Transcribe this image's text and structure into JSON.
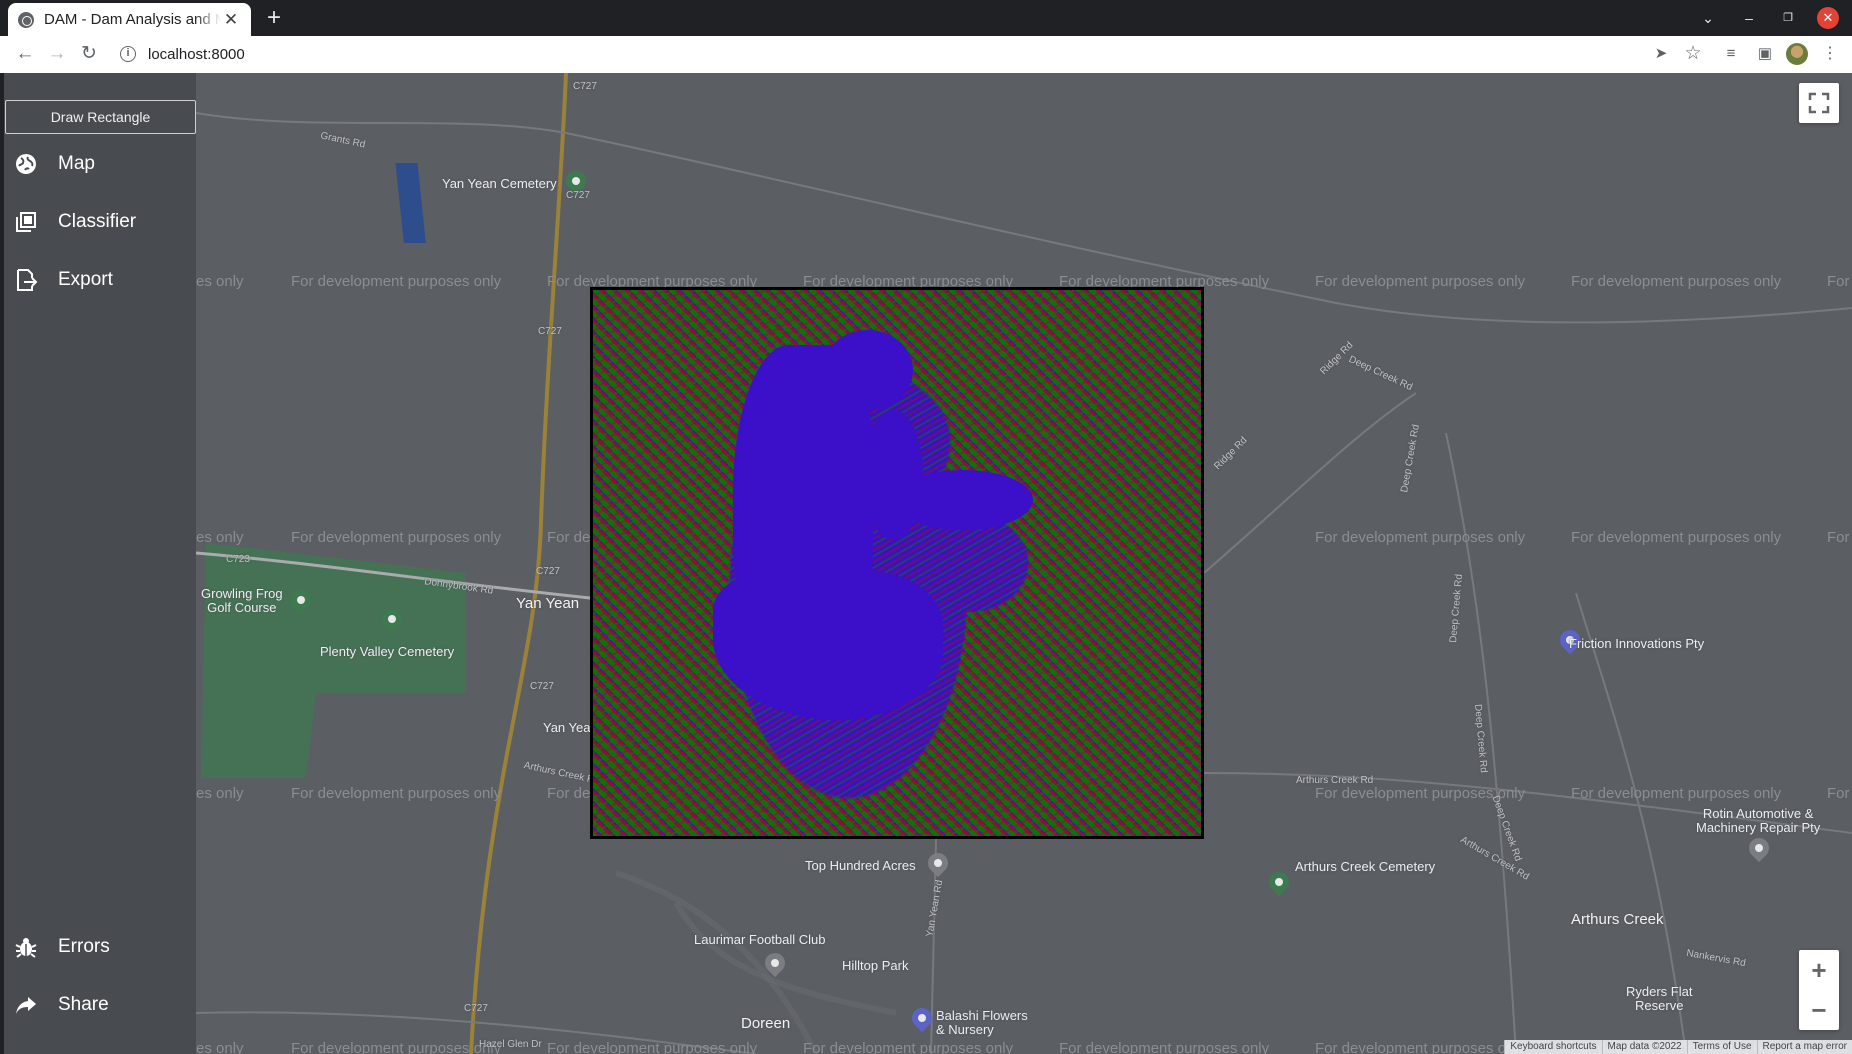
{
  "browser": {
    "tab_title": "DAM - Dam Analysis and Management",
    "new_tab": "+",
    "url": "localhost:8000"
  },
  "sidebar": {
    "draw_rectangle": "Draw Rectangle",
    "items": [
      {
        "label": "Map",
        "icon": "globe-icon"
      },
      {
        "label": "Classifier",
        "icon": "layers-icon"
      },
      {
        "label": "Export",
        "icon": "export-icon"
      },
      {
        "label": "Errors",
        "icon": "bug-icon"
      },
      {
        "label": "Share",
        "icon": "share-icon"
      }
    ]
  },
  "map": {
    "watermark": "For development purposes only",
    "watermark_fragment_left": "es only",
    "watermark_fragment_right": "For",
    "watermark_fragment_mid": "For de",
    "places": {
      "yan_yean_cemetery": "Yan Yean Cemetery",
      "grants_rd": "Grants Rd",
      "growling_frog": "Growling Frog\nGolf Course",
      "plenty_valley": "Plenty Valley Cemetery",
      "donnybrook_rd": "Donnybrook Rd",
      "yan_yean": "Yan Yean",
      "yan_yean_small": "Yan Yea",
      "arthurs_creek_rd": "Arthurs Creek Rd",
      "top_hundred": "Top Hundred Acres",
      "laurimar": "Laurimar Football Club",
      "hilltop": "Hilltop Park",
      "doreen": "Doreen",
      "balashi": "Balashi Flowers\n& Nursery",
      "hazel_glen": "Hazel Glen Dr",
      "arthurs_creek_cemetery": "Arthurs Creek Cemetery",
      "arthurs_creek": "Arthurs Creek",
      "ryders": "Ryders Flat\nReserve",
      "friction": "Friction Innovations Pty",
      "rotin": "Rotin Automotive &\nMachinery Repair Pty",
      "ridge_rd": "Ridge Rd",
      "deep_creek_rd": "Deep Creek Rd",
      "nankervis": "Nankervis Rd",
      "c727": "C727",
      "c723": "C723",
      "yan_yean_rd": "Yan Yean Rd"
    },
    "zoom_in": "+",
    "zoom_out": "−",
    "attribution": {
      "keyboard": "Keyboard shortcuts",
      "mapdata": "Map data ©2022",
      "terms": "Terms of Use",
      "report": "Report a map error"
    }
  },
  "colors": {
    "sidebar": "#484b4f",
    "map_bg": "#5b5e63",
    "class_water": "#3b10c8",
    "class_vegetation": "#146e0c",
    "class_other": "#8b1237"
  }
}
